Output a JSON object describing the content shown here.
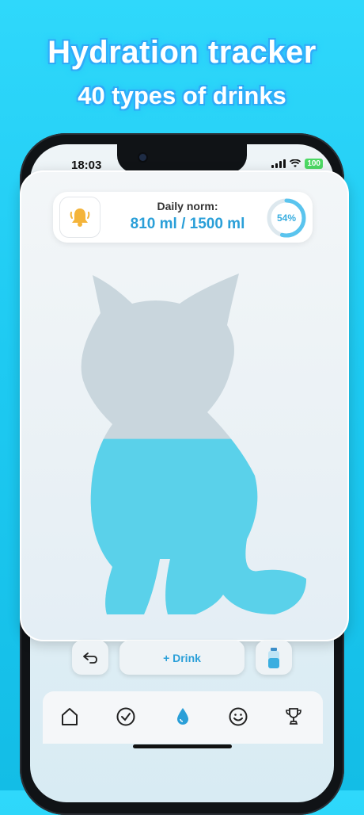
{
  "headline": {
    "title": "Hydration tracker",
    "subtitle": "40 types of drinks"
  },
  "status_bar": {
    "time": "18:03",
    "battery": "100"
  },
  "daily_norm": {
    "label": "Daily norm:",
    "value": "810 ml / 1500 ml",
    "percent_text": "54%",
    "percent": 54,
    "icon": "bell-icon"
  },
  "fill_level_percent": 54,
  "controls": {
    "undo_icon": "undo-arrow-icon",
    "drink_label": "+ Drink",
    "bottle_icon": "water-bottle-icon"
  },
  "tabs": [
    {
      "icon": "home-icon",
      "active": false
    },
    {
      "icon": "checkmark-circle-icon",
      "active": false
    },
    {
      "icon": "water-drop-icon",
      "active": true
    },
    {
      "icon": "smiley-icon",
      "active": false
    },
    {
      "icon": "trophy-icon",
      "active": false
    }
  ],
  "colors": {
    "accent": "#2a9fd8",
    "water": "#5ad1ea",
    "background": "#1ecaf2",
    "bell": "#f4b43a"
  }
}
